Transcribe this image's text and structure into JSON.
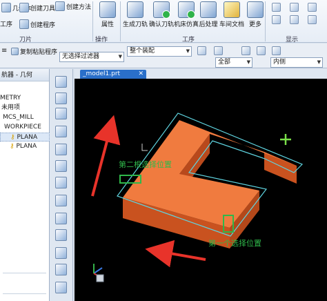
{
  "ribbon": {
    "top_left_1": "几何体",
    "top_left_2": "工序",
    "create_tool": "创建刀具",
    "create_program": "创建程序",
    "create_method": "创建方法",
    "tool_group_label": "刀片",
    "properties": "属性",
    "operations_label": "操作",
    "generate_toolpath": "生成刀轨",
    "verify_toolpath": "确认刀轨",
    "machine_sim": "机床仿真",
    "postprocess": "后处理",
    "shop_doc": "车间文档",
    "more": "更多",
    "ops_group_label": "工序",
    "display_label": "显示"
  },
  "toolbar2": {
    "copy_paste": "复制粘贴程序",
    "filter": "无选择过滤器",
    "assembly": "整个装配",
    "all": "全部",
    "inside": "内侧"
  },
  "navigator": {
    "title": "航器 - 几何",
    "items": [
      "METRY",
      "未用项",
      "MCS_MILL",
      "WORKPIECE",
      "PLANA",
      "PLANA"
    ]
  },
  "graphics": {
    "tab_label": "_model1.prt",
    "annotation_second": "第二根选择位置",
    "annotation_first": "第一个选择位置",
    "colors": {
      "part_top": "#f07b3f",
      "part_side": "#c9521f",
      "boundary": "#5fd4e0",
      "annotation": "#2fb84a",
      "arrow": "#e8332a"
    }
  }
}
